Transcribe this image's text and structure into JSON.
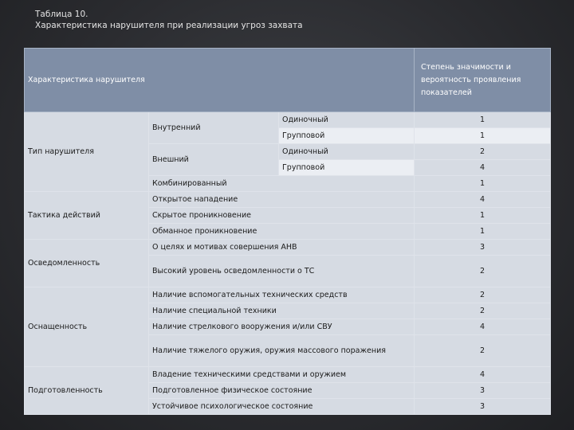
{
  "caption": {
    "line1": "Таблица 10.",
    "line2": "Характеристика нарушителя при реализации угроз захвата"
  },
  "header": {
    "col1": "Характеристика нарушителя",
    "col2": "Степень значимости и вероятность проявления показателей"
  },
  "type": {
    "label": "Тип нарушителя",
    "internal": "Внутренний",
    "external": "Внешний",
    "single": "Одиночный",
    "group": "Групповой",
    "combined": "Комбинированный",
    "v_int_single": "1",
    "v_int_group": "1",
    "v_ext_single": "2",
    "v_ext_group": "4",
    "v_combined": "1"
  },
  "tactics": {
    "label": "Тактика действий",
    "r1": "Открытое нападение",
    "v1": "4",
    "r2": "Скрытое проникновение",
    "v2": "1",
    "r3": "Обманное проникновение",
    "v3": "1"
  },
  "awareness": {
    "label": "Осведомленность",
    "r1": "О целях и мотивах совершения АНВ",
    "v1": "3",
    "r2": "Высокий уровень осведомленности о ТС",
    "v2": "2"
  },
  "equipment": {
    "label": "Оснащенность",
    "r1": "Наличие вспомогательных технических средств",
    "v1": "2",
    "r2": "Наличие специальной техники",
    "v2": "2",
    "r3": "Наличие стрелкового вооружения и/или СВУ",
    "v3": "4",
    "r4": "Наличие тяжелого оружия, оружия массового поражения",
    "v4": "2"
  },
  "training": {
    "label": "Подготовленность",
    "r1": "Владение техническими средствами и оружием",
    "v1": "4",
    "r2": "Подготовленное физическое состояние",
    "v2": "3",
    "r3": "Устойчивое психологическое состояние",
    "v3": "3"
  }
}
